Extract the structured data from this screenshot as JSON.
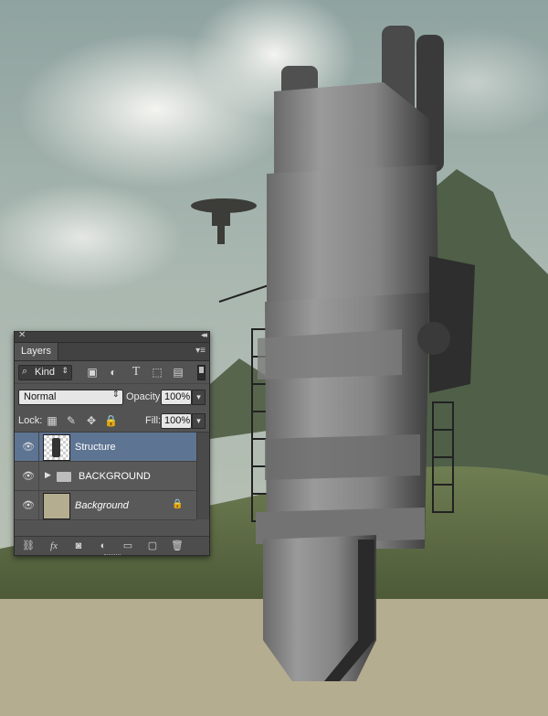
{
  "panel": {
    "tab_label": "Layers",
    "filter": {
      "kind_label": "Kind"
    },
    "blend_mode": "Normal",
    "opacity_label": "Opacity:",
    "opacity_value": "100%",
    "lock_label": "Lock:",
    "fill_label": "Fill:",
    "fill_value": "100%",
    "layers": [
      {
        "name": "Structure",
        "selected": true,
        "type": "pixel"
      },
      {
        "name": "BACKGROUND",
        "selected": false,
        "type": "group"
      },
      {
        "name": "Background",
        "selected": false,
        "type": "background",
        "italic": true
      }
    ]
  },
  "colors": {
    "canvas_beige": "#b5ad90",
    "selected_layer": "#5e7493",
    "panel_bg": "#535353"
  }
}
